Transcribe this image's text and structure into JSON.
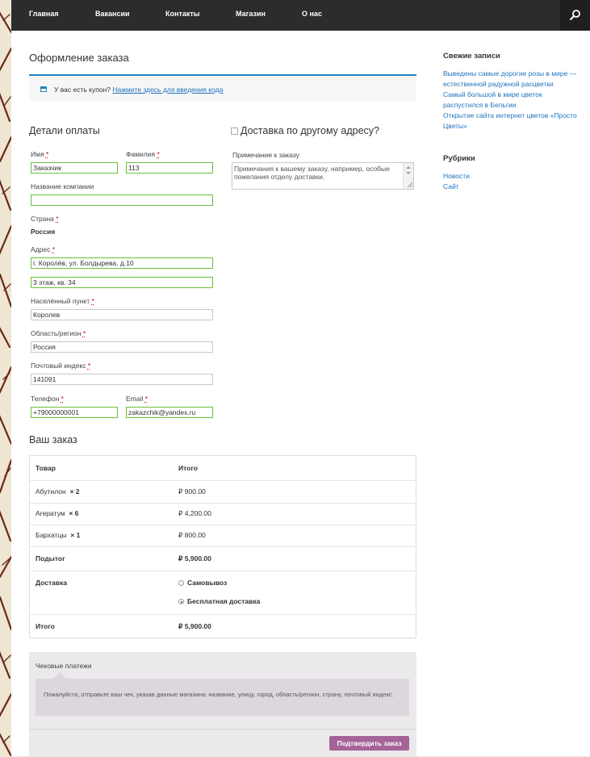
{
  "nav": {
    "items": [
      "Главная",
      "Вакансии",
      "Контакты",
      "Магазин",
      "О нас"
    ],
    "search_icon": "search-icon"
  },
  "page": {
    "title": "Оформление заказа"
  },
  "coupon": {
    "text": "У вас есть купон?",
    "link": "Нажмите здесь для введения кода"
  },
  "billing": {
    "title": "Детали оплаты",
    "first_name": {
      "label": "Имя",
      "value": "Заказчик"
    },
    "last_name": {
      "label": "Фамилия",
      "value": "113"
    },
    "company": {
      "label": "Название компании",
      "value": ""
    },
    "country": {
      "label": "Страна",
      "value": "Россия"
    },
    "address": {
      "label": "Адрес",
      "value1": "г. Королёв, ул. Болдырева, д.10",
      "value2": "3 этаж, кв. 34"
    },
    "city": {
      "label": "Населённый пункт",
      "value": "Королев"
    },
    "region": {
      "label": "Область/регион",
      "value": "Россия"
    },
    "postcode": {
      "label": "Почтовый индекс",
      "value": "141091"
    },
    "phone": {
      "label": "Телефон",
      "value": "+79000000001"
    },
    "email": {
      "label": "Email",
      "value": "zakazchik@yandex.ru"
    },
    "required_mark": "*"
  },
  "shipping": {
    "title": "Доставка по другому адресу?",
    "notes_label": "Примечание к заказу",
    "notes_placeholder": "Примечания к вашему заказу, например, особые пожелания отделу доставки."
  },
  "order": {
    "title": "Ваш заказ",
    "col_product": "Товар",
    "col_total": "Итого",
    "items": [
      {
        "name": "Абутилон",
        "qty": "× 2",
        "total": "₽ 900.00"
      },
      {
        "name": "Агератум",
        "qty": "× 6",
        "total": "₽ 4,200.00"
      },
      {
        "name": "Бархатцы",
        "qty": "× 1",
        "total": "₽ 800.00"
      }
    ],
    "subtotal_label": "Подытог",
    "subtotal_value": "₽ 5,900.00",
    "shipping_label": "Доставка",
    "shipping_options": [
      "Самовывоз",
      "Бесплатная доставка"
    ],
    "shipping_selected": 1,
    "total_label": "Итого",
    "total_value": "₽ 5,900.00"
  },
  "payment": {
    "method": "Чековые платежи",
    "description": "Пожалуйста, отправьте ваш чек, указав данные магазина: название, улицу, город, область/регион, страну, почтовый индекс.",
    "button": "Подтвердить заказ"
  },
  "sidebar": {
    "recent_title": "Свежие записи",
    "recent": [
      "Выведены самые дорогие розы в мире — естественной радужной расцветки",
      "Самый большой в мире цветок распустился в Бельгии",
      "Открытие сайта интернет цветов «Просто Цветы»"
    ],
    "categories_title": "Рубрики",
    "categories": [
      "Новости",
      "Сайт"
    ]
  },
  "colors": {
    "accent": "#1e85be",
    "button": "#a46497",
    "valid_border": "#6bbf3a",
    "topbar": "#2c2c2c"
  }
}
